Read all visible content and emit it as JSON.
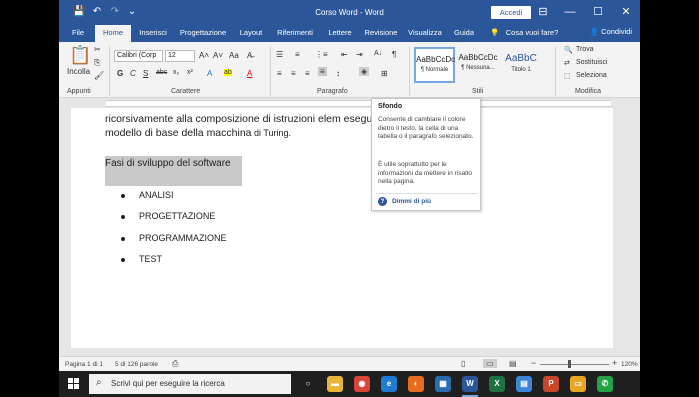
{
  "titlebar": {
    "doc_title": "Corso Word  -  Word",
    "signin": "Accedi",
    "save_glyph": "💾",
    "undo_glyph": "↶",
    "redo_glyph": "↷",
    "customize_glyph": "⌄",
    "display_options_glyph": "⊟",
    "minimize_glyph": "—",
    "maximize_glyph": "☐",
    "close_glyph": "✕"
  },
  "tabs": [
    {
      "label": "File"
    },
    {
      "label": "Home"
    },
    {
      "label": "Inserisci"
    },
    {
      "label": "Progettazione"
    },
    {
      "label": "Layout"
    },
    {
      "label": "Riferimenti"
    },
    {
      "label": "Lettere"
    },
    {
      "label": "Revisione"
    },
    {
      "label": "Visualizza"
    },
    {
      "label": "Guida"
    }
  ],
  "tell_me": {
    "icon": "lightbulb-icon",
    "glyph": "💡",
    "label": "Cosa vuoi fare?"
  },
  "share": {
    "glyph": "👤",
    "label": "Condividi"
  },
  "ribbon": {
    "clipboard": {
      "paste_label": "Incolla",
      "group_label": "Appunti",
      "paste_glyph": "📋",
      "cut_glyph": "✂",
      "copy_glyph": "⎘",
      "format_glyph": "🖌"
    },
    "font": {
      "font_name": "Calibri (Corp",
      "font_size": "12",
      "group_label": "Carattere",
      "grow_glyph": "A˄",
      "shrink_glyph": "A˅",
      "case_glyph": "Aa",
      "clear_glyph": "A̶",
      "bold": "G",
      "italic": "C",
      "underline": "S",
      "strike": "abc",
      "subscript": "x₂",
      "superscript": "x²",
      "effects_glyph": "A",
      "highlight_glyph": "ab",
      "color_glyph": "A"
    },
    "paragraph": {
      "group_label": "Paragrafo",
      "bullets_glyph": "☰",
      "numbering_glyph": "≡",
      "multilevel_glyph": "⋮≡",
      "indent_dec_glyph": "⇤",
      "indent_inc_glyph": "⇥",
      "sort_glyph": "A↓",
      "pilcrow_glyph": "¶",
      "align_left_glyph": "≡",
      "align_center_glyph": "≡",
      "align_right_glyph": "≡",
      "justify_glyph": "≡",
      "spacing_glyph": "↕",
      "shading_glyph": "◈",
      "borders_glyph": "⊞"
    },
    "styles": {
      "group_label": "Stili",
      "items": [
        {
          "sample": "AaBbCcDc",
          "name": "¶ Normale"
        },
        {
          "sample": "AaBbCcDc",
          "name": "¶ Nessuna..."
        },
        {
          "sample": "AaBbC",
          "name": "Titolo 1"
        }
      ]
    },
    "editing": {
      "group_label": "Modifica",
      "find": "Trova",
      "replace": "Sostituisci",
      "select": "Seleziona",
      "find_glyph": "🔍",
      "replace_glyph": "⇄",
      "select_glyph": "⬚"
    }
  },
  "document": {
    "line1": "ricorsivamente  alla  composizione  di istruzioni elem                                     eseguibili  con  il",
    "line2_main": "modello di base della macchina",
    "line2_tail": " di Turing.",
    "heading": "Fasi di sviluppo del software",
    "bullets": [
      "ANALISI",
      "PROGETTAZIONE",
      "PROGRAMMAZIONE",
      "TEST"
    ]
  },
  "tooltip": {
    "title": "Sfondo",
    "body1": "Consente di cambiare il colore dietro il testo, la cella di una tabella o il paragrafo selezionato.",
    "body2": "È utile soprattutto per le informazioni da mettere in risalto nella pagina.",
    "help_icon": "?",
    "help": "Dimmi di più"
  },
  "status": {
    "page": "Pagina 1 di 1",
    "words": "5 di 126 parole",
    "proof_glyph": "⎙",
    "read_mode_glyph": "▯",
    "print_layout_glyph": "▭",
    "web_layout_glyph": "▤",
    "zoom_minus": "−",
    "zoom_plus": "+",
    "zoom": "120%",
    "zoom_fraction": 0.42
  },
  "taskbar": {
    "search_glyph": "⌕",
    "search_placeholder": "Scrivi qui per eseguire la ricerca",
    "apps": [
      {
        "icon": "cortana-icon",
        "glyph": "○",
        "color": "#1f1f1f"
      },
      {
        "icon": "file-explorer-icon",
        "glyph": "▬",
        "color": "#e8b73a"
      },
      {
        "icon": "chrome-icon",
        "glyph": "◉",
        "color": "#d9453a"
      },
      {
        "icon": "edge-icon",
        "glyph": "e",
        "color": "#1f7ad1"
      },
      {
        "icon": "firefox-icon",
        "glyph": "◐",
        "color": "#e86b1f"
      },
      {
        "icon": "photos-icon",
        "glyph": "▦",
        "color": "#2b6cb0"
      },
      {
        "icon": "word-icon",
        "glyph": "W",
        "color": "#2b579a"
      },
      {
        "icon": "excel-icon",
        "glyph": "X",
        "color": "#1e7145"
      },
      {
        "icon": "store-icon",
        "glyph": "▤",
        "color": "#3a86d4"
      },
      {
        "icon": "powerpoint-icon",
        "glyph": "P",
        "color": "#c8472b"
      },
      {
        "icon": "folder-icon",
        "glyph": "▭",
        "color": "#e8a623"
      },
      {
        "icon": "whatsapp-icon",
        "glyph": "✆",
        "color": "#25a244"
      }
    ]
  },
  "colors": {
    "word_blue": "#2b579a",
    "taskbar": "#1f1f1f",
    "selection": "#c8c8c8"
  }
}
